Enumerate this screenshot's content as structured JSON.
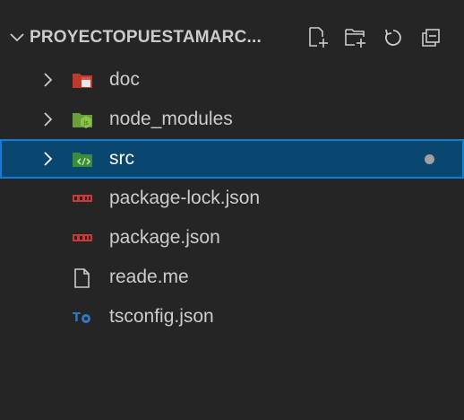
{
  "explorer": {
    "title": "PROYECTOPUESTAMARC...",
    "actions": [
      {
        "name": "new-file-icon"
      },
      {
        "name": "new-folder-icon"
      },
      {
        "name": "refresh-icon"
      },
      {
        "name": "collapse-all-icon"
      }
    ]
  },
  "tree": {
    "items": [
      {
        "label": "doc",
        "kind": "folder",
        "icon": "folder-doc-icon",
        "icon_color": "#e05252"
      },
      {
        "label": "node_modules",
        "kind": "folder",
        "icon": "folder-node-icon",
        "icon_color": "#8bc34a"
      },
      {
        "label": "src",
        "kind": "folder",
        "icon": "folder-src-icon",
        "icon_color": "#4caf50",
        "selected": true,
        "modified_dot_color": "#a0a0a0"
      },
      {
        "label": "package-lock.json",
        "kind": "file",
        "icon": "npm-icon",
        "icon_color": "#cb3837"
      },
      {
        "label": "package.json",
        "kind": "file",
        "icon": "npm-icon",
        "icon_color": "#cb3837"
      },
      {
        "label": "reade.me",
        "kind": "file",
        "icon": "file-icon",
        "icon_color": "#cccccc"
      },
      {
        "label": "tsconfig.json",
        "kind": "file",
        "icon": "typescript-icon",
        "icon_color": "#3178c6"
      }
    ]
  },
  "colors": {
    "background": "#252526",
    "selection_bg": "#094771",
    "selection_border": "#0e7fd6",
    "text": "#cccccc"
  }
}
